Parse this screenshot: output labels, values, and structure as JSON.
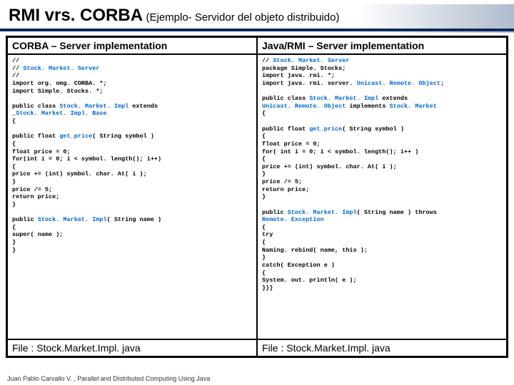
{
  "title_main": "RMI vrs. CORBA",
  "title_sub": "(Ejemplo- Servidor del objeto distribuido)",
  "col_left_header": "CORBA – Server implementation",
  "col_right_header": "Java/RMI – Server implementation",
  "code_left": "//\n// Stock. Market. Server\n//\nimport org. omg. CORBA. *;\nimport Simple. Stocks. *;\n\npublic class Stock. Market. Impl extends\n_Stock. Market. Impl. Base\n{\n\npublic float get_price( String symbol )\n{\nfloat price = 0;\nfor(int i = 0; i < symbol. length(); i++)\n{\nprice += (int) symbol. char. At( i );\n}\nprice /= 5;\nreturn price;\n}\n\npublic Stock. Market. Impl( String name )\n{\nsuper( name );\n}\n}",
  "code_right": "// Stock. Market. Server\npackage Simple. Stocks;\nimport java. rmi. *;\nimport java. rmi. server. Unicast. Remote. Object;\n\npublic class Stock. Market. Impl extends\nUnicast. Remote. Object implements Stock. Market\n{\n\npublic float get_price( String symbol )\n{\nfloat price = 0;\nfor( int i = 0; i < symbol. length(); i++ )\n{\nprice += (int) symbol. char. At( i );\n}\nprice /= 5;\nreturn price;\n}\n\npublic Stock. Market. Impl( String name ) throws\nRemote. Exception\n{\ntry\n{\nNaming. rebind( name, this );\n}\ncatch( Exception e )\n{\nSystem. out. println( e );\n}}}",
  "file_left": "File : Stock.Market.Impl. java",
  "file_right": "File : Stock.Market.Impl. java",
  "footer": "Juan Pablo Carvallo V. , Parallel and Distributed Computing Using Java"
}
